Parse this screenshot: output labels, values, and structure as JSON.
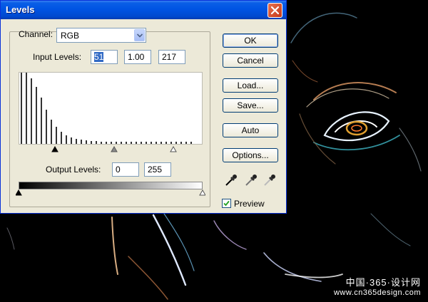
{
  "dialog": {
    "title": "Levels",
    "close_icon": "close-icon"
  },
  "channel": {
    "label": "Channel:",
    "value": "RGB"
  },
  "input_levels": {
    "label": "Input Levels:",
    "black": "51",
    "gamma": "1.00",
    "white": "217"
  },
  "output_levels": {
    "label": "Output Levels:",
    "black": "0",
    "white": "255"
  },
  "buttons": {
    "ok": "OK",
    "cancel": "Cancel",
    "load": "Load...",
    "save": "Save...",
    "auto": "Auto",
    "options": "Options..."
  },
  "preview": {
    "label": "Preview",
    "checked": true
  },
  "eyedroppers": [
    "black-eyedropper-icon",
    "gray-eyedropper-icon",
    "white-eyedropper-icon"
  ],
  "watermark": {
    "line1": "中国·365·设计网",
    "line2": "www.cn365design.com"
  },
  "colors": {
    "title_bar": "#0054e3",
    "dialog_bg": "#ece9d8",
    "selection": "#316ac5",
    "close_button": "#d65838"
  }
}
